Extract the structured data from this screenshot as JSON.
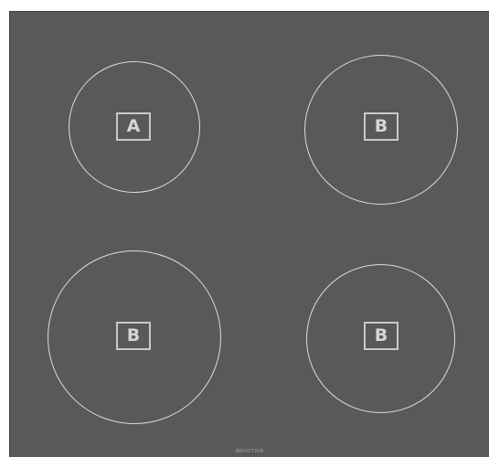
{
  "cooktop": {
    "brand_label": "INDUCTION",
    "zones": [
      {
        "label": "A"
      },
      {
        "label": "B"
      },
      {
        "label": "B"
      },
      {
        "label": "B"
      }
    ]
  }
}
